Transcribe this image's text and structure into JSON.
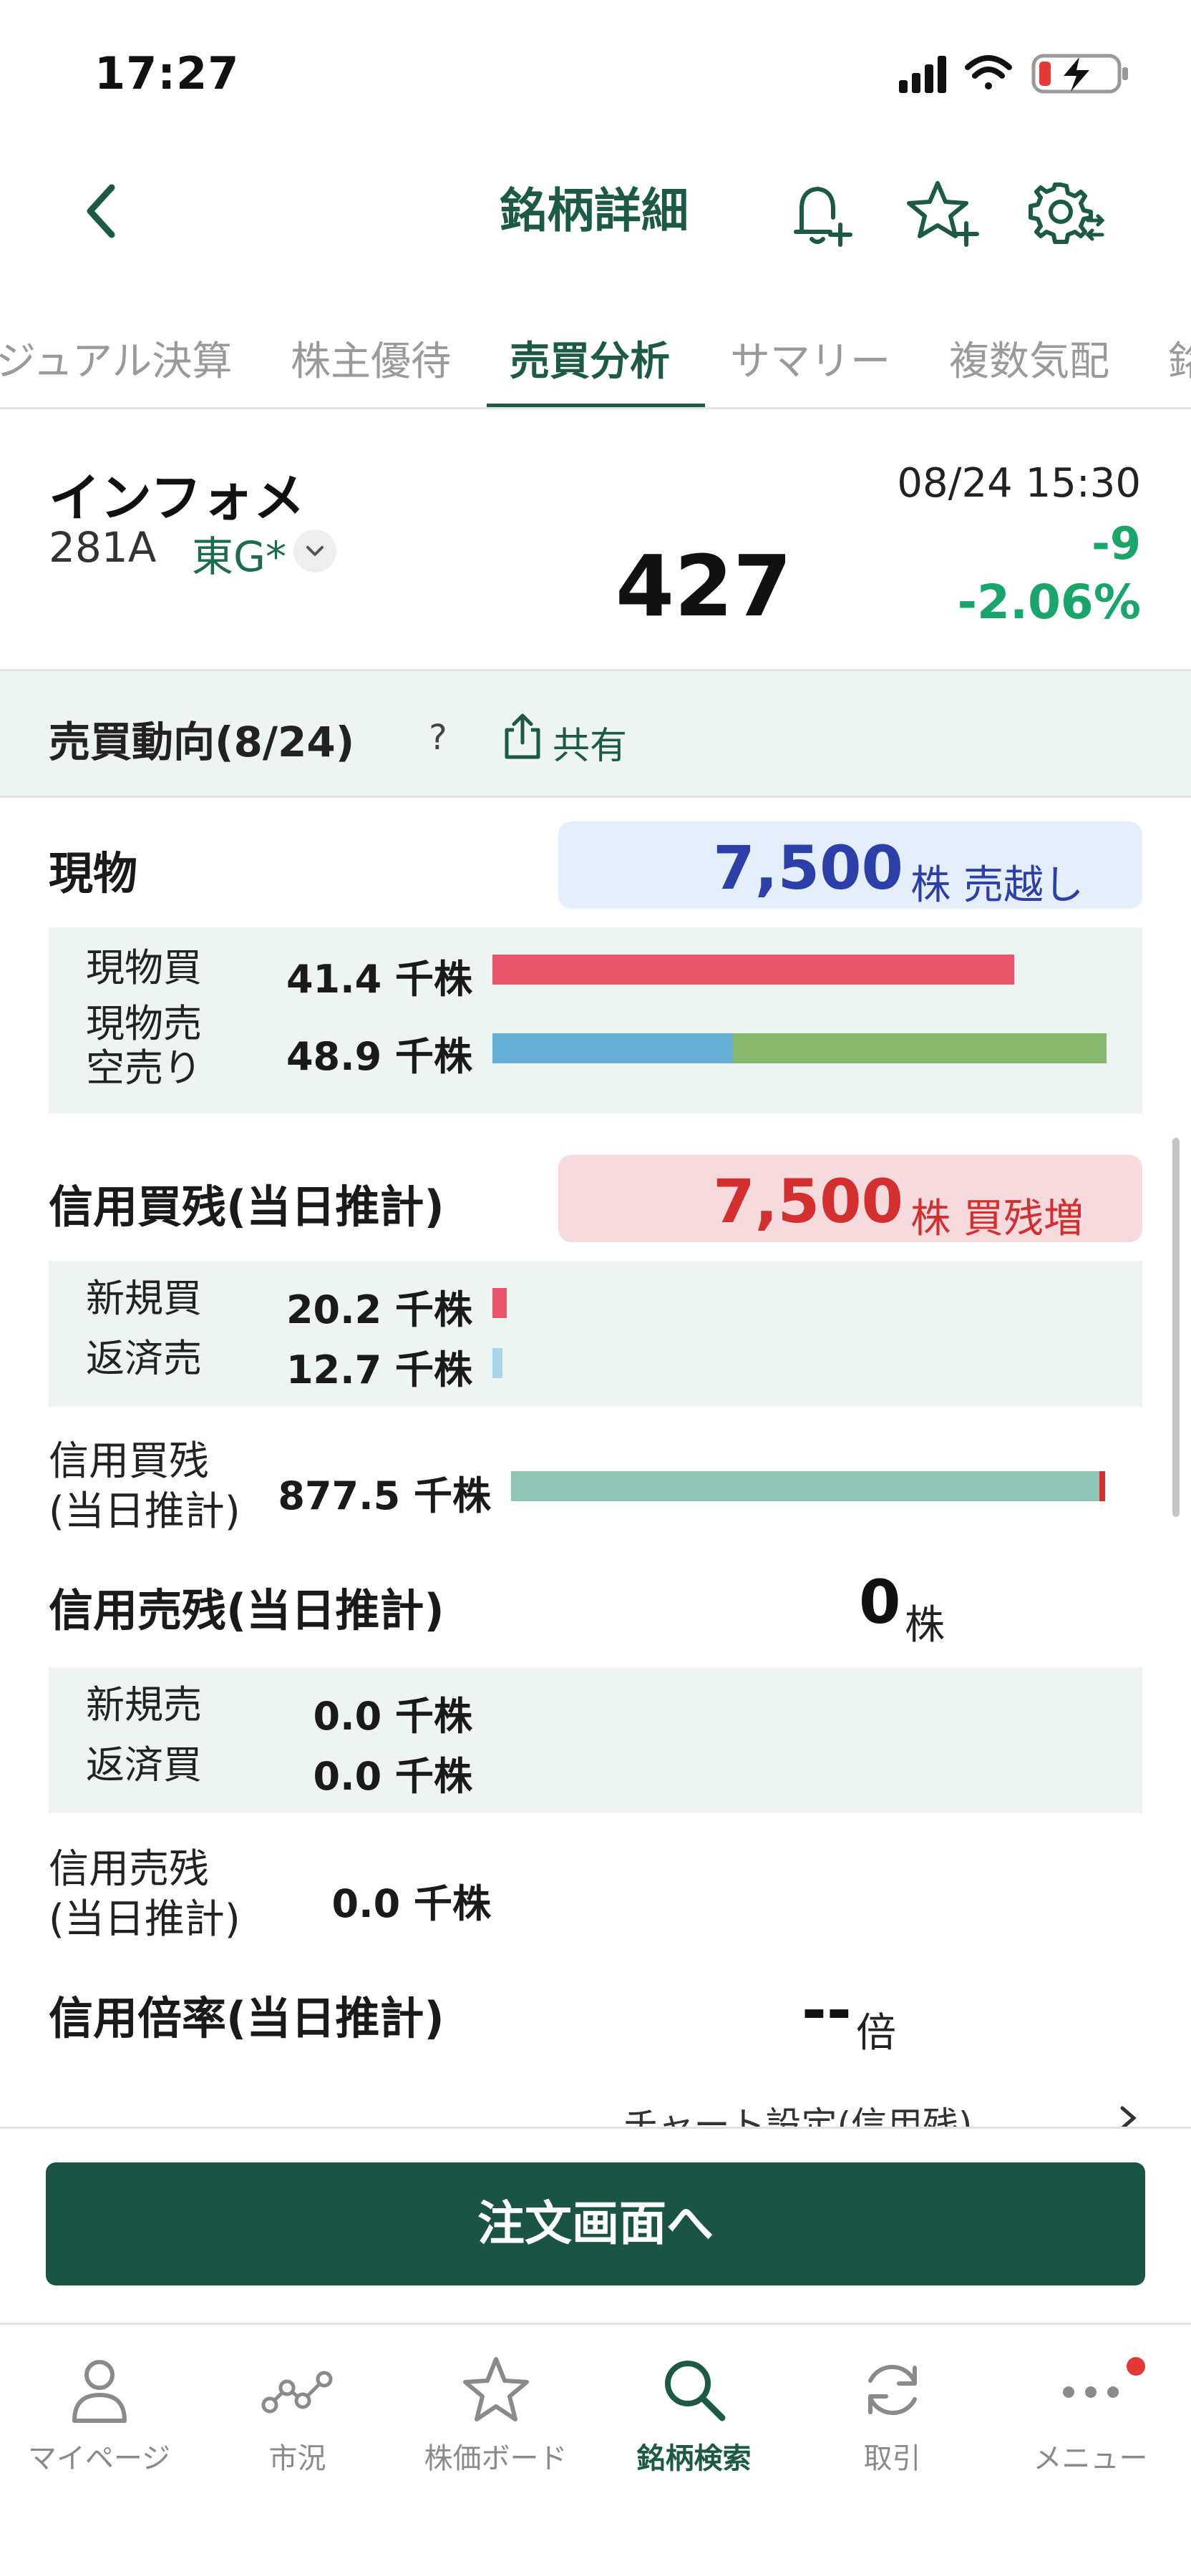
{
  "status_bar": {
    "time": "17:27"
  },
  "header": {
    "title": "銘柄詳細"
  },
  "tabs": [
    {
      "label": "ジュアル決算"
    },
    {
      "label": "株主優待"
    },
    {
      "label": "売買分析"
    },
    {
      "label": "サマリー"
    },
    {
      "label": "複数気配"
    },
    {
      "label": "銘"
    }
  ],
  "stock": {
    "name": "インフォメ",
    "code": "281A",
    "market": "東G*",
    "datetime": "08/24 15:30",
    "price": "427",
    "change": "-9",
    "change_pct": "-2.06%"
  },
  "trend": {
    "title": "売買動向(8/24)",
    "help": "?",
    "share": "共有"
  },
  "spot": {
    "title": "現物",
    "net_value": "7,500",
    "net_unit": "株 売越し",
    "buy_label": "現物買",
    "buy_value": "41.4 千株",
    "sell_label_1": "現物売",
    "sell_label_2": "空売り",
    "sell_value": "48.9 千株",
    "buy_bar_fraction": 0.85,
    "sell_bar_spot_fraction": 0.39,
    "sell_bar_short_fraction": 0.61
  },
  "margin_buy": {
    "title": "信用買残(当日推計)",
    "net_value": "7,500",
    "net_unit": "株 買残増",
    "new_label": "新規買",
    "new_value": "20.2 千株",
    "repay_label": "返済売",
    "repay_value": "12.7 千株",
    "balance_label_1": "信用買残",
    "balance_label_2": "(当日推計)",
    "balance_value": "877.5 千株"
  },
  "margin_sell": {
    "title": "信用売残(当日推計)",
    "net_value": "0",
    "net_unit": "株",
    "new_label": "新規売",
    "new_value": "0.0 千株",
    "repay_label": "返済買",
    "repay_value": "0.0 千株",
    "balance_label_1": "信用売残",
    "balance_label_2": "(当日推計)",
    "balance_value": "0.0 千株"
  },
  "ratio": {
    "title": "信用倍率(当日推計)",
    "value": "--",
    "unit": "倍"
  },
  "chart_link": "チャート設定(信用残)",
  "order_button": "注文画面へ",
  "tabbar": [
    {
      "label": "マイページ",
      "icon": "person-icon"
    },
    {
      "label": "市況",
      "icon": "market-chart-icon"
    },
    {
      "label": "株価ボード",
      "icon": "star-icon"
    },
    {
      "label": "銘柄検索",
      "icon": "search-icon"
    },
    {
      "label": "取引",
      "icon": "refresh-icon"
    },
    {
      "label": "メニュー",
      "icon": "more-icon"
    }
  ],
  "colors": {
    "brand": "#1d5a45",
    "up_green": "#1aa56a",
    "sell_blue": "#2c3fa8",
    "buy_red": "#d32f2f",
    "buy_bar": "#e8566e",
    "spot_sell_bar": "#66b0d8",
    "short_sell_bar": "#88b86c",
    "balance_bar": "#8fc5b6"
  }
}
